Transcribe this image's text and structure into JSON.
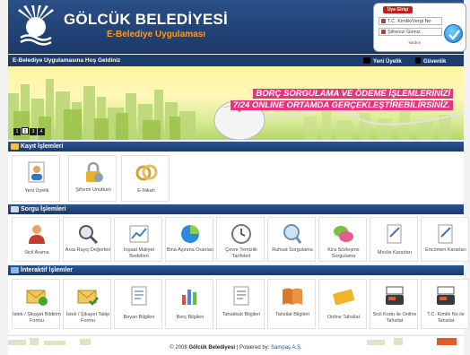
{
  "header": {
    "title": "GÖLCÜK BELEDİYESİ",
    "subtitle": "E-Belediye Uygulaması",
    "login": {
      "tab_label": "Üye Girişi",
      "id_field": "T.C. Kimlik/Vergi No",
      "password_field": "Şifrenizi Giriniz",
      "help_link": "Yardım"
    }
  },
  "navbar": {
    "welcome": "E-Belediye Uygulamasına Hoş Geldiniz",
    "new_member": "Yeni Üyelik",
    "security": "Güvenlik"
  },
  "banner": {
    "line1": "BORÇ SORGULAMA VE ÖDEME İŞLEMLERİNİZİ",
    "line2": "7/24 ONLINE ORTAMDA GERÇEKLEŞTİREBİLİRSİNİZ.",
    "slides": [
      "1",
      "2",
      "3",
      "4"
    ],
    "active_slide": 1
  },
  "sections": {
    "kayit": {
      "title": "Kayıt İşlemleri",
      "items": [
        {
          "label": "Yeni Üyelik",
          "icon": "new-user-icon"
        },
        {
          "label": "Şifremi Unuttum",
          "icon": "lock-icon"
        },
        {
          "label": "E-Nikah",
          "icon": "rings-icon"
        }
      ]
    },
    "sorgu": {
      "title": "Sorgu İşlemleri",
      "items": [
        {
          "label": "Sicil Arama",
          "icon": "person-icon"
        },
        {
          "label": "Arsa Rayiç Değerleri",
          "icon": "magnifier-icon"
        },
        {
          "label": "İnşaat Maliyet Bedelleri",
          "icon": "chart-icon"
        },
        {
          "label": "Bina Aşınma Oranları",
          "icon": "pie-chart-icon"
        },
        {
          "label": "Çevre Temizlik Tarifeleri",
          "icon": "clock-icon"
        },
        {
          "label": "Ruhsat Sorgulama",
          "icon": "badge-search-icon"
        },
        {
          "label": "Kira Sözleşme Sorgulama",
          "icon": "chat-bubbles-icon"
        },
        {
          "label": "Meclis Kararları",
          "icon": "document-pen-icon"
        },
        {
          "label": "Encümen Kararları",
          "icon": "document-pen-icon"
        }
      ]
    },
    "interaktif": {
      "title": "İnteraktif İşlemler",
      "items": [
        {
          "label": "İstek / Şikayet Bildirim Formu",
          "icon": "mail-add-icon"
        },
        {
          "label": "İstek / Şikayet Takip Formu",
          "icon": "mail-check-icon"
        },
        {
          "label": "Beyan Bilgileri",
          "icon": "document-list-icon"
        },
        {
          "label": "Borç Bilgileri",
          "icon": "bar-chart-icon"
        },
        {
          "label": "Tahakkuk Bilgileri",
          "icon": "document-list-icon"
        },
        {
          "label": "Tahsilat Bilgileri",
          "icon": "book-icon"
        },
        {
          "label": "Online Tahsilat",
          "icon": "credit-card-icon"
        },
        {
          "label": "Sicil Kodu ile Online Tahsilat",
          "icon": "card-terminal-icon"
        },
        {
          "label": "T.C. Kimlik No ile Tahsilat",
          "icon": "card-terminal-icon"
        }
      ]
    }
  },
  "footer": {
    "copyright": "© 2008",
    "org": "Gölcük Belediyesi",
    "powered": "| Powered by:",
    "vendor": "Sampaş A.Ş."
  },
  "colors": {
    "brand_blue": "#1d3b6c",
    "accent_orange": "#ff9a1f",
    "banner_pink": "#e8337e"
  }
}
